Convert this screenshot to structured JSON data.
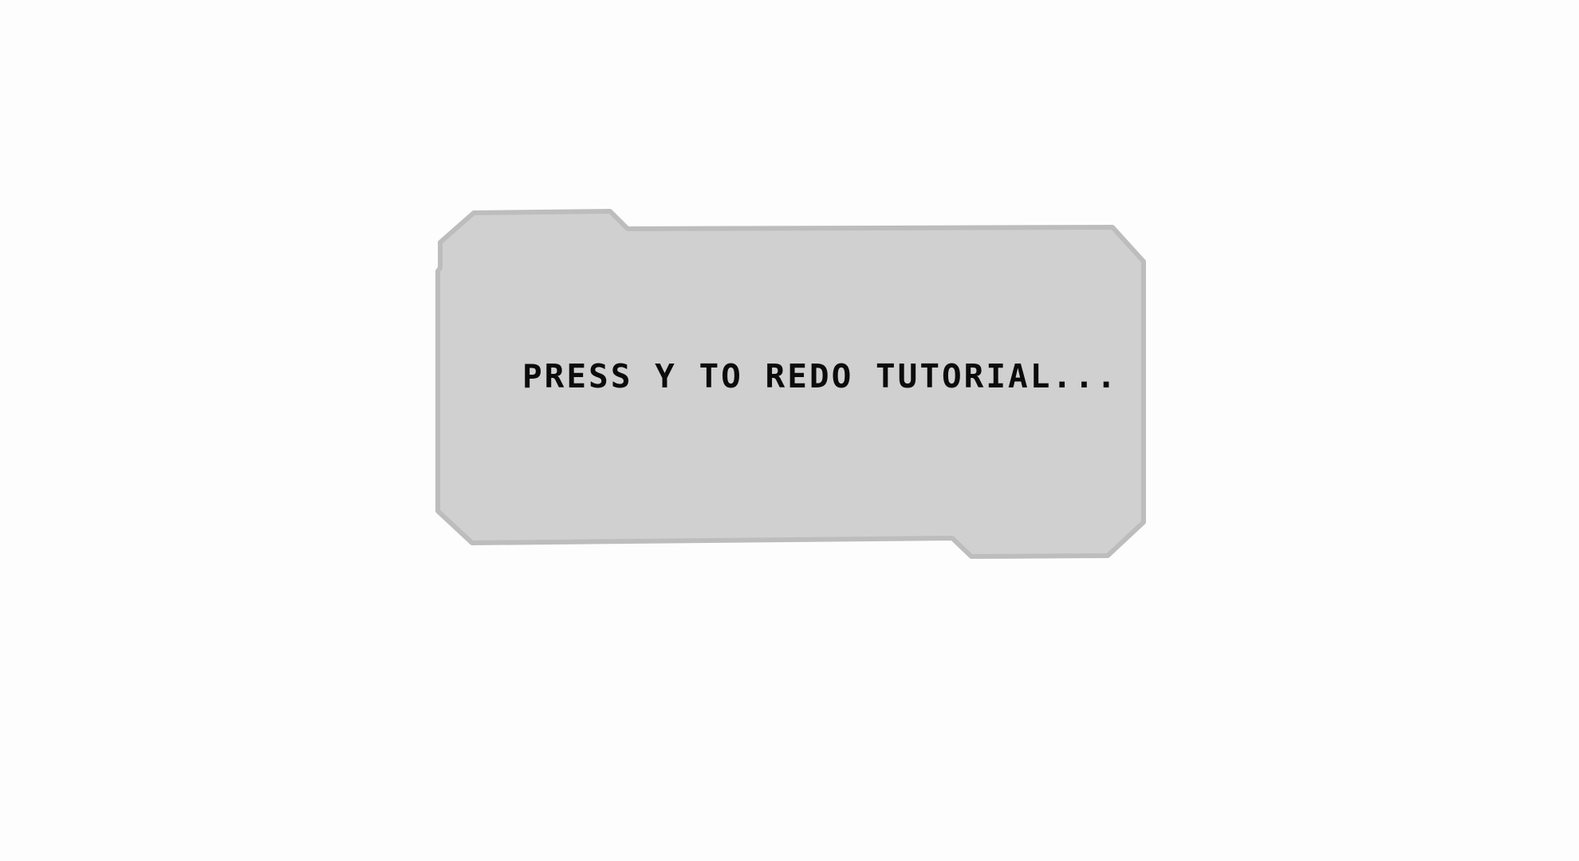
{
  "dialog": {
    "message": "PRESS Y TO REDO TUTORIAL..."
  },
  "colors": {
    "background": "#fdfdfd",
    "panel_fill": "#d0d0d0",
    "panel_border": "#bdbdbd",
    "text": "#0b0b0b"
  }
}
